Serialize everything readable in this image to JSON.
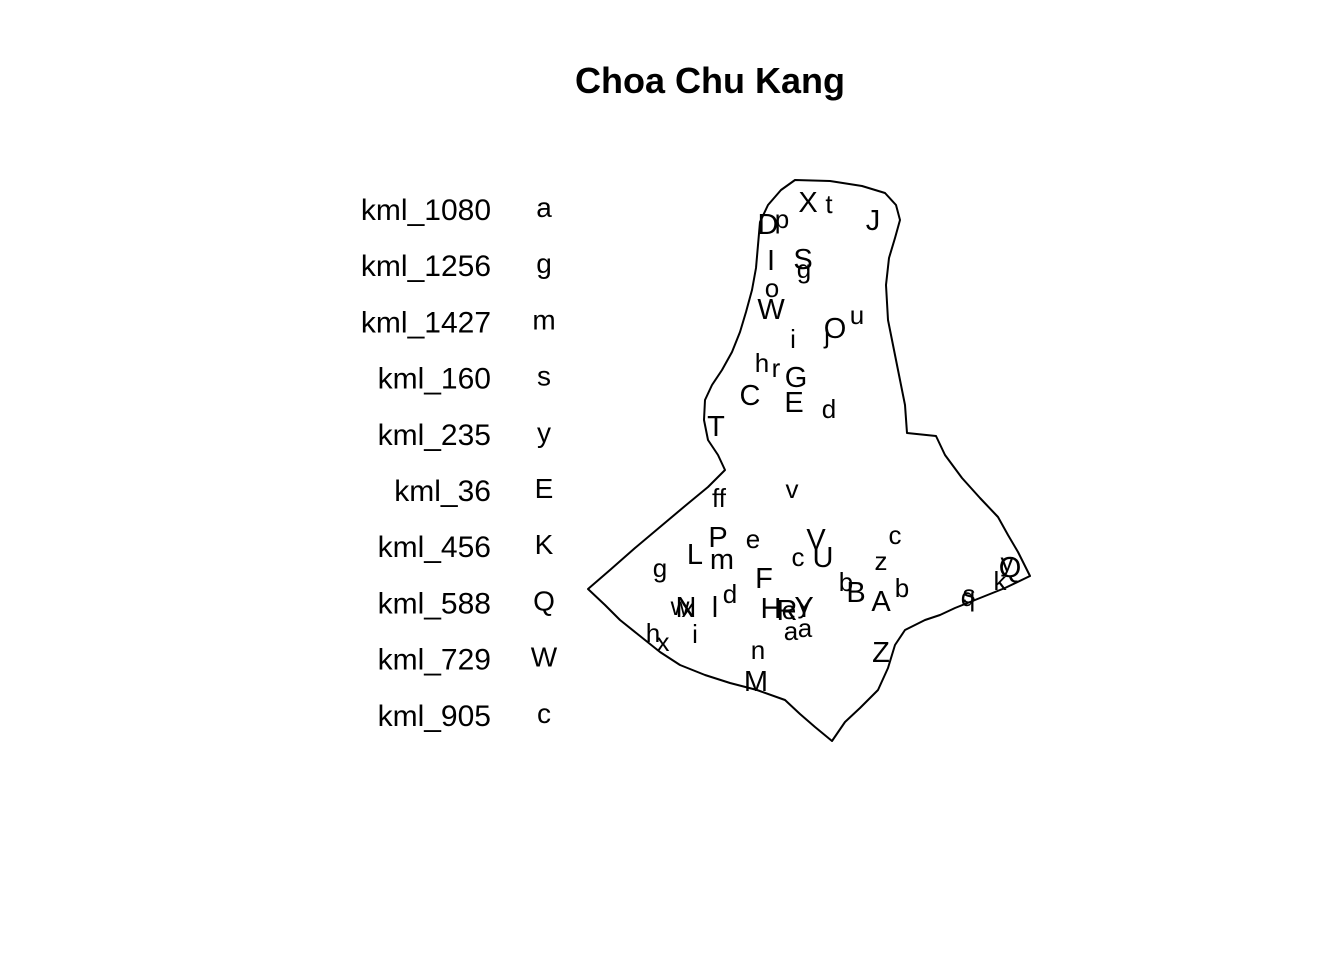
{
  "title": "Choa Chu Kang",
  "legend": [
    {
      "name": "kml_1080",
      "code": "a"
    },
    {
      "name": "kml_1256",
      "code": "g"
    },
    {
      "name": "kml_1427",
      "code": "m"
    },
    {
      "name": "kml_160",
      "code": "s"
    },
    {
      "name": "kml_235",
      "code": "y"
    },
    {
      "name": "kml_36",
      "code": "E"
    },
    {
      "name": "kml_456",
      "code": "K"
    },
    {
      "name": "kml_588",
      "code": "Q"
    },
    {
      "name": "kml_729",
      "code": "W"
    },
    {
      "name": "kml_905",
      "code": "c"
    }
  ],
  "map_labels": [
    {
      "t": "X"
    },
    {
      "t": "t"
    },
    {
      "t": "p"
    },
    {
      "t": "D"
    },
    {
      "t": "J"
    },
    {
      "t": "I"
    },
    {
      "t": "S"
    },
    {
      "t": "g"
    },
    {
      "t": "o"
    },
    {
      "t": "W"
    },
    {
      "t": "u"
    },
    {
      "t": "O"
    },
    {
      "t": "j"
    },
    {
      "t": "i"
    },
    {
      "t": "h"
    },
    {
      "t": "r"
    },
    {
      "t": "G"
    },
    {
      "t": "C"
    },
    {
      "t": "E"
    },
    {
      "t": "d"
    },
    {
      "t": "T"
    },
    {
      "t": "v"
    },
    {
      "t": "ff"
    },
    {
      "t": "P"
    },
    {
      "t": "e"
    },
    {
      "t": "V"
    },
    {
      "t": "c"
    },
    {
      "t": "L"
    },
    {
      "t": "m"
    },
    {
      "t": "c"
    },
    {
      "t": "U"
    },
    {
      "t": "z"
    },
    {
      "t": "g"
    },
    {
      "t": "F"
    },
    {
      "t": "b"
    },
    {
      "t": "B"
    },
    {
      "t": "b"
    },
    {
      "t": "y"
    },
    {
      "t": "Q"
    },
    {
      "t": "k"
    },
    {
      "t": "s"
    },
    {
      "t": "q"
    },
    {
      "t": "d"
    },
    {
      "t": "A"
    },
    {
      "t": "w"
    },
    {
      "t": "x"
    },
    {
      "t": "N"
    },
    {
      "t": "l"
    },
    {
      "t": "H"
    },
    {
      "t": "e"
    },
    {
      "t": "R"
    },
    {
      "t": "Y"
    },
    {
      "t": "y"
    },
    {
      "t": "a"
    },
    {
      "t": "a"
    },
    {
      "t": "h"
    },
    {
      "t": "x"
    },
    {
      "t": "i"
    },
    {
      "t": "n"
    },
    {
      "t": "Z"
    },
    {
      "t": "M"
    }
  ]
}
